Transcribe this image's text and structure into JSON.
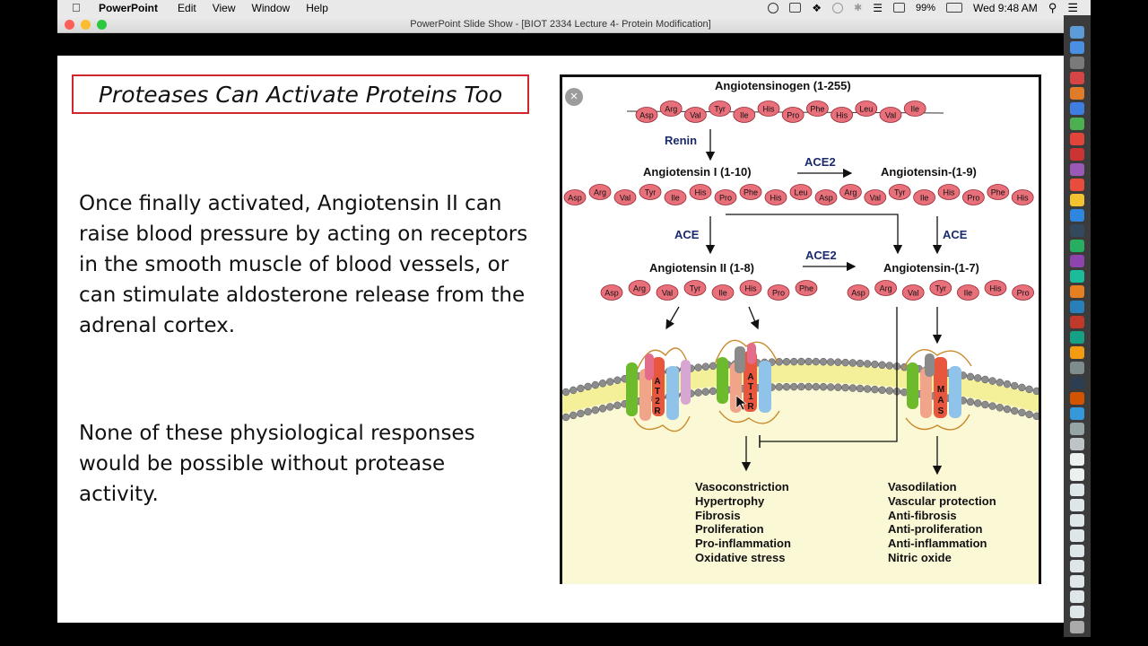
{
  "menubar": {
    "app_name": "PowerPoint",
    "menus": [
      "Edit",
      "View",
      "Window",
      "Help"
    ],
    "battery": "99%",
    "clock": "Wed 9:48 AM"
  },
  "window": {
    "title": "PowerPoint Slide Show - [BIOT 2334 Lecture 4- Protein Modification]"
  },
  "slide": {
    "title": "Proteases Can Activate Proteins Too",
    "paragraph1": "Once finally activated, Angiotensin II can raise blood pressure by acting on receptors in the smooth muscle of blood vessels, or can stimulate aldosterone release from the adrenal cortex.",
    "paragraph2": "None of these physiological responses would be possible without protease activity."
  },
  "figure": {
    "close_symbol": "×",
    "angiotensinogen_label": "Angiotensinogen (1-255)",
    "angiotensinogen_residues": [
      "Asp",
      "Arg",
      "Val",
      "Tyr",
      "Ile",
      "His",
      "Pro",
      "Phe",
      "His",
      "Leu",
      "Val",
      "Ile"
    ],
    "renin_label": "Renin",
    "ang1_label": "Angiotensin I (1-10)",
    "ang1_residues": [
      "Asp",
      "Arg",
      "Val",
      "Tyr",
      "Ile",
      "His",
      "Pro",
      "Phe",
      "His",
      "Leu"
    ],
    "ace2_top_label": "ACE2",
    "ang19_label": "Angiotensin-(1-9)",
    "ang19_residues": [
      "Asp",
      "Arg",
      "Val",
      "Tyr",
      "Ile",
      "His",
      "Pro",
      "Phe",
      "His"
    ],
    "ace_left_label": "ACE",
    "ace_right_label": "ACE",
    "ang2_label": "Angiotensin II (1-8)",
    "ang2_residues": [
      "Asp",
      "Arg",
      "Val",
      "Tyr",
      "Ile",
      "His",
      "Pro",
      "Phe"
    ],
    "ace2_mid_label": "ACE2",
    "ang17_label": "Angiotensin-(1-7)",
    "ang17_residues": [
      "Asp",
      "Arg",
      "Val",
      "Tyr",
      "Ile",
      "His",
      "Pro"
    ],
    "receptor_at2r": [
      "A",
      "T",
      "2",
      "R"
    ],
    "receptor_at1r": [
      "A",
      "T",
      "1",
      "R"
    ],
    "receptor_mas": [
      "M",
      "A",
      "S"
    ],
    "effects_left": [
      "Vasoconstriction",
      "Hypertrophy",
      "Fibrosis",
      "Proliferation",
      "Pro-inflammation",
      "Oxidative stress"
    ],
    "effects_right": [
      "Vasodilation",
      "Vascular protection",
      "Anti-fibrosis",
      "Anti-proliferation",
      "Anti-inflammation",
      "Nitric oxide"
    ],
    "colors": {
      "bead_fill": "#e8707a",
      "bead_stroke": "#9a2a35",
      "arrow_text": "#1a2a6c",
      "membrane_head": "#8c8c8c",
      "membrane_tail": "#f4f09a",
      "cytoplasm": "#fbf8d6"
    }
  }
}
